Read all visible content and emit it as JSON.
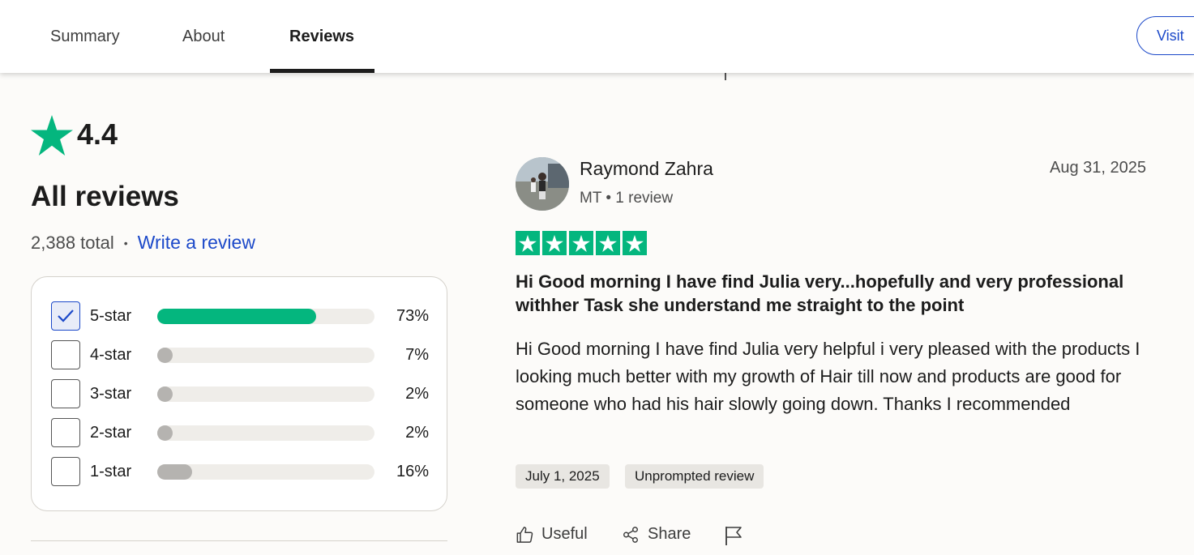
{
  "nav": {
    "tabs": [
      {
        "label": "Summary"
      },
      {
        "label": "About"
      },
      {
        "label": "Reviews",
        "active": true
      }
    ],
    "visit_label": "Visit"
  },
  "ghost": {
    "useful": "Useful",
    "share": "Share"
  },
  "summary": {
    "rating": "4.4",
    "heading": "All reviews",
    "total": "2,388 total",
    "separator": "•",
    "write_review": "Write a review",
    "distribution": [
      {
        "label": "5-star",
        "percent_text": "73%",
        "fraction": 0.73,
        "checked": true
      },
      {
        "label": "4-star",
        "percent_text": "7%",
        "fraction": 0.07,
        "checked": false
      },
      {
        "label": "3-star",
        "percent_text": "2%",
        "fraction": 0.02,
        "checked": false
      },
      {
        "label": "2-star",
        "percent_text": "2%",
        "fraction": 0.02,
        "checked": false
      },
      {
        "label": "1-star",
        "percent_text": "16%",
        "fraction": 0.16,
        "checked": false
      }
    ]
  },
  "review": {
    "name": "Raymond Zahra",
    "meta": "MT • 1 review",
    "date": "Aug 31, 2025",
    "stars": 5,
    "title": "Hi Good morning I have find Julia very...hopefully and very professional withher Task she understand me straight to the point",
    "body": "Hi Good morning I have find Julia very helpful i very pleased with the products I looking much better with my growth of Hair till now and products are good for someone who had his hair slowly going down. Thanks I recommended",
    "experience_date": "July 1, 2025",
    "badge": "Unprompted review",
    "actions": {
      "useful": "Useful",
      "share": "Share"
    }
  },
  "colors": {
    "brand_green": "#04b67e",
    "link_blue": "#1c49c9",
    "bar_gray": "#b5b3b0"
  }
}
